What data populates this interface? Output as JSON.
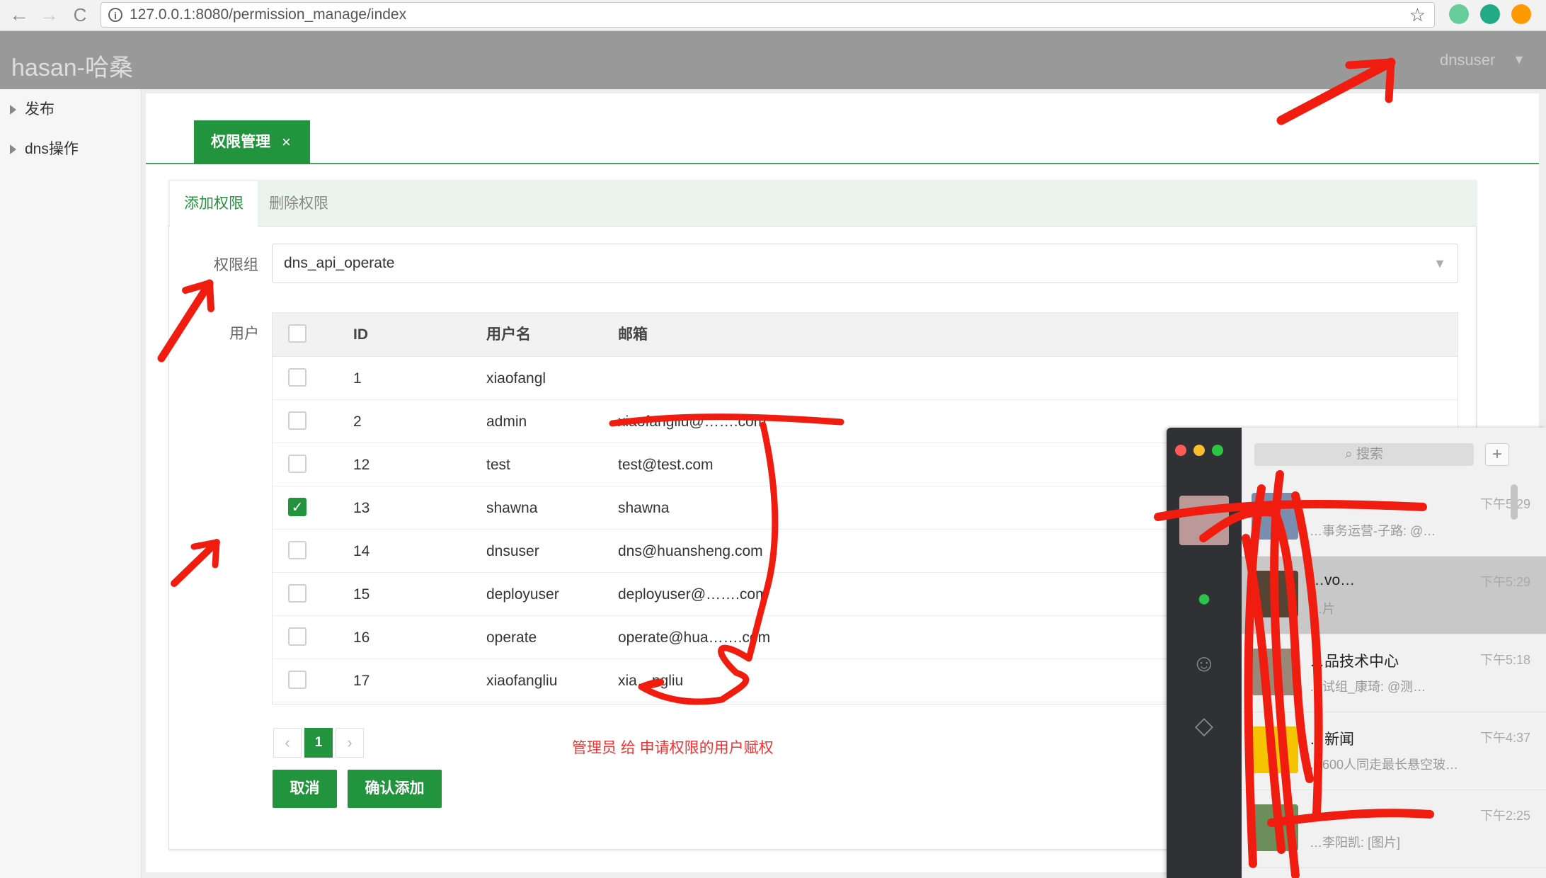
{
  "browser": {
    "back_glyph": "←",
    "forward_glyph": "→",
    "reload_glyph": "C",
    "info_glyph": "i",
    "url": "127.0.0.1:8080/permission_manage/index",
    "star_glyph": "☆",
    "extension_colors": [
      "#6c9",
      "#2a8",
      "#f90"
    ]
  },
  "header": {
    "brand": "hasan-哈桑",
    "user": "dnsuser",
    "caret": "▼"
  },
  "sidebar": {
    "items": [
      {
        "label": "发布"
      },
      {
        "label": "dns操作"
      }
    ]
  },
  "tabs": {
    "active_label": "权限管理",
    "close_glyph": "×"
  },
  "subtabs": {
    "add": "添加权限",
    "delete": "删除权限"
  },
  "form": {
    "group_label": "权限组",
    "group_value": "dns_api_operate",
    "select_caret": "▼",
    "user_label": "用户"
  },
  "table": {
    "headers": {
      "id": "ID",
      "username": "用户名",
      "email": "邮箱"
    },
    "rows": [
      {
        "id": "1",
        "username": "xiaofangl",
        "email": "",
        "checked": false
      },
      {
        "id": "2",
        "username": "admin",
        "email": "xiaofangliu@…….com",
        "checked": false
      },
      {
        "id": "12",
        "username": "test",
        "email": "test@test.com",
        "checked": false
      },
      {
        "id": "13",
        "username": "shawna",
        "email": "shawna",
        "checked": true
      },
      {
        "id": "14",
        "username": "dnsuser",
        "email": "dns@huansheng.com",
        "checked": false
      },
      {
        "id": "15",
        "username": "deployuser",
        "email": "deployuser@…….com",
        "checked": false
      },
      {
        "id": "16",
        "username": "operate",
        "email": "operate@hua…….com",
        "checked": false
      },
      {
        "id": "17",
        "username": "xiaofangliu",
        "email": "xia…ngliu",
        "checked": false
      }
    ],
    "check_glyph": "✓"
  },
  "pagination": {
    "prev": "‹",
    "current": "1",
    "next": "›"
  },
  "note": "管理员 给  申请权限的用户赋权",
  "buttons": {
    "cancel": "取消",
    "confirm": "确认添加"
  },
  "wechat": {
    "search_placeholder": "搜索",
    "search_glyph": "⌕",
    "plus": "+",
    "chats": [
      {
        "name": "……",
        "time": "下午5:29",
        "msg": "…事务运营-子路: @…",
        "thumb_color": "#7a8fb0"
      },
      {
        "name": "…vo…",
        "time": "下午5:29",
        "msg": "…片",
        "thumb_color": "#543"
      },
      {
        "name": "…品技术中心",
        "time": "下午5:18",
        "msg": "…试组_康琦: @测…",
        "thumb_color": "#998877"
      },
      {
        "name": "…新闻",
        "time": "下午4:37",
        "msg": "…600人同走最长悬空玻…",
        "thumb_color": "#f5c400"
      },
      {
        "name": "……",
        "time": "下午2:25",
        "msg": "…李阳凯: [图片]",
        "thumb_color": "#6b8e5a"
      }
    ]
  },
  "annotation_color": "#f01c10"
}
